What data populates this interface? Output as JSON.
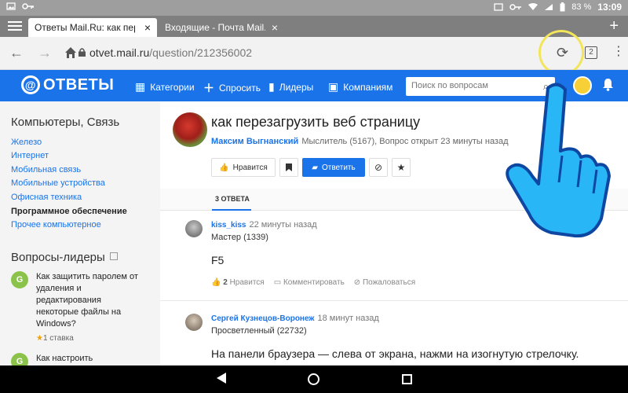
{
  "status_bar": {
    "battery": "83 %",
    "time": "13:09"
  },
  "tabs": [
    {
      "title": "Ответы Mail.Ru: как пер",
      "close": "×"
    },
    {
      "title": "Входящие - Почта Mail.",
      "close": "×"
    }
  ],
  "browser": {
    "url_host": "otvet.mail.ru",
    "url_path": "/question/212356002",
    "tab_count": "2"
  },
  "site": {
    "logo": "ОТВЕТЫ",
    "menu": [
      "Категории",
      "Спросить",
      "Лидеры",
      "Компаниям"
    ],
    "search_placeholder": "Поиск по вопросам"
  },
  "sidebar": {
    "category_title": "Компьютеры, Связь",
    "categories": [
      "Железо",
      "Интернет",
      "Мобильная связь",
      "Мобильные устройства",
      "Офисная техника",
      "Программное обеспечение",
      "Прочее компьютерное"
    ],
    "leaders_title": "Вопросы-лидеры",
    "leaders": [
      {
        "avatar": "G",
        "question_lines": [
          "Как защитить паролем от",
          "удаления и",
          "редактирования",
          "некоторые файлы на",
          "Windows?"
        ],
        "meta": "1 ставка"
      },
      {
        "avatar": "G",
        "question_lines": [
          "Как настроить"
        ],
        "meta": ""
      }
    ]
  },
  "question": {
    "title": "как перезагрузить веб страницу",
    "author": "Максим Выгнанский",
    "meta": "Мыслитель (5167), Вопрос открыт 23 минуты назад",
    "like_label": "Нравится",
    "answer_label": "Ответить"
  },
  "answers_tab": "3 ОТВЕТА",
  "answers": [
    {
      "name": "kiss_kiss",
      "time": "22 минуты назад",
      "rank": "Мастер (1339)",
      "text": "F5",
      "likes": "2",
      "likes_label": "Нравится",
      "comment_label": "Комментировать",
      "report_label": "Пожаловаться"
    },
    {
      "name": "Сергей Кузнецов-Воронеж",
      "time": "18 минут назад",
      "rank": "Просветленный (22732)",
      "text": "На панели браузера — слева от экрана, нажми на изогнутую стрелочку."
    }
  ],
  "colors": {
    "accent": "#1a73e8",
    "status_bar": "#9e9e9e",
    "highlight": "#f3e55a",
    "hand": "#29b6f6"
  }
}
